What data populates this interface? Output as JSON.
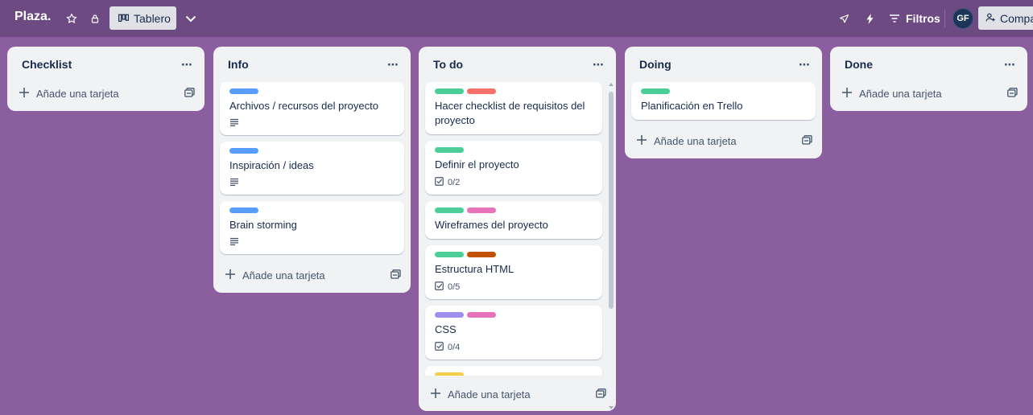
{
  "header": {
    "board_title": "Plaza.",
    "view_label": "Tablero",
    "filters_label": "Filtros",
    "avatar_initials": "GF",
    "share_label": "Compartir"
  },
  "lists": [
    {
      "title": "Checklist",
      "add_label": "Añade una tarjeta",
      "cards": []
    },
    {
      "title": "Info",
      "add_label": "Añade una tarjeta",
      "cards": [
        {
          "title": "Archivos / recursos del proyecto",
          "labels": [
            "#579dff"
          ],
          "description": true
        },
        {
          "title": "Inspiración / ideas",
          "labels": [
            "#579dff"
          ],
          "description": true
        },
        {
          "title": "Brain storming",
          "labels": [
            "#579dff"
          ],
          "description": true
        }
      ]
    },
    {
      "title": "To do",
      "add_label": "Añade una tarjeta",
      "cards": [
        {
          "title": "Hacer checklist de requisitos del proyecto",
          "labels": [
            "#4bce97",
            "#f87168"
          ]
        },
        {
          "title": "Definir el proyecto",
          "labels": [
            "#4bce97"
          ],
          "checklist": "0/2"
        },
        {
          "title": "Wireframes del proyecto",
          "labels": [
            "#4bce97",
            "#e774bb"
          ]
        },
        {
          "title": "Estructura HTML",
          "labels": [
            "#4bce97",
            "#c25100"
          ],
          "checklist": "0/5"
        },
        {
          "title": "CSS",
          "labels": [
            "#9f8fef",
            "#e774bb"
          ],
          "checklist": "0/4"
        },
        {
          "title": "",
          "labels": [
            "#f5cd47"
          ]
        }
      ]
    },
    {
      "title": "Doing",
      "add_label": "Añade una tarjeta",
      "cards": [
        {
          "title": "Planificación en Trello",
          "labels": [
            "#4bce97"
          ]
        }
      ]
    },
    {
      "title": "Done",
      "add_label": "Añade una tarjeta",
      "cards": []
    }
  ]
}
